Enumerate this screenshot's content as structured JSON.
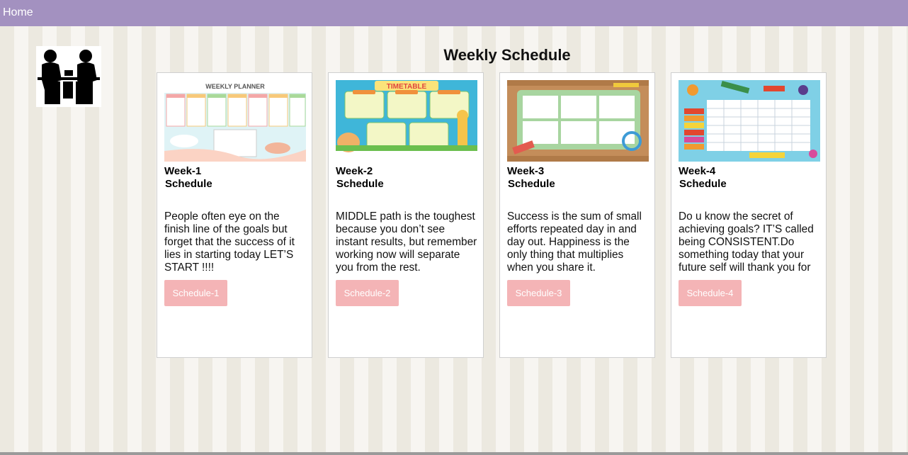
{
  "nav": {
    "home_label": "Home"
  },
  "page": {
    "title": "Weekly Schedule"
  },
  "cards": [
    {
      "title_line1": "Week-1",
      "title_line2": "Schedule",
      "text": "People often eye on the finish line of the goals but forget that the success of it lies in starting today LET’S START !!!!",
      "button_label": "Schedule-1",
      "image_text": "WEEKLY PLANNER",
      "image_icon": "weekly-planner-image"
    },
    {
      "title_line1": "Week-2",
      "title_line2": "Schedule",
      "text": "MIDDLE path is the toughest because you don’t see instant results, but remember working now will separate you from the rest.",
      "button_label": "Schedule-2",
      "image_text": "TIMETABLE",
      "image_icon": "timetable-image"
    },
    {
      "title_line1": "Week-3",
      "title_line2": "Schedule",
      "text": "Success is the sum of small efforts repeated day in and day out. Happiness is the only thing that multiplies when you share it.",
      "button_label": "Schedule-3",
      "image_icon": "schedule-board-image"
    },
    {
      "title_line1": "Week-4",
      "title_line2": "Schedule",
      "text": "Do u know the secret of achieving goals? IT’S called being CONSISTENT.Do something today that your future self will thank you for",
      "button_label": "Schedule-4",
      "image_icon": "school-supplies-timetable-image"
    }
  ],
  "colors": {
    "topbar": "#a391c0",
    "button": "#f4b4b6",
    "stripe_dark": "#ece9e0",
    "stripe_light": "#f7f5f1"
  }
}
